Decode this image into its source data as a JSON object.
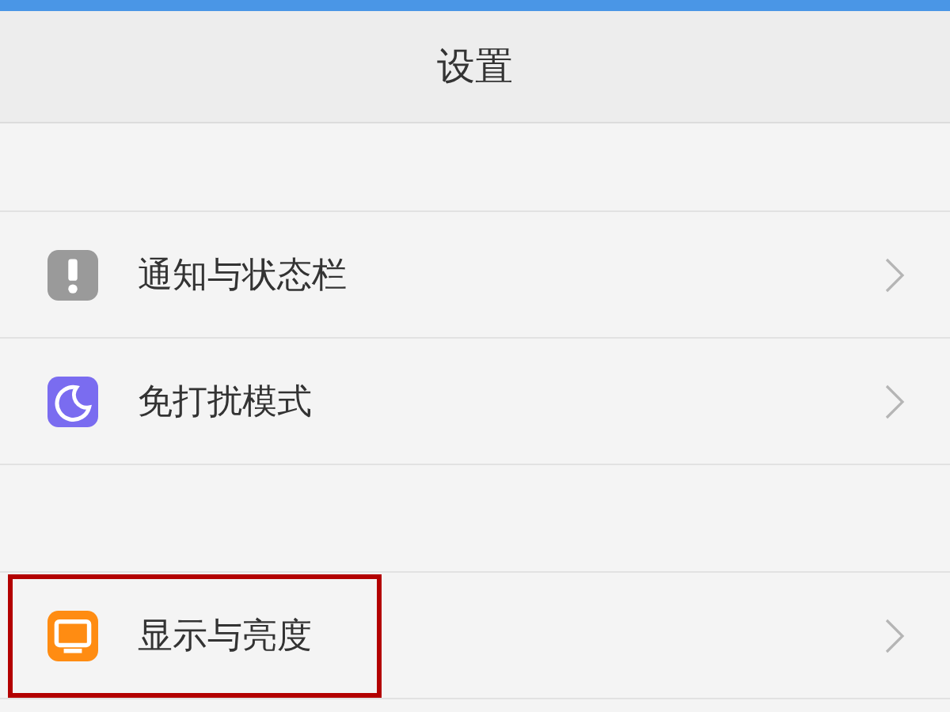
{
  "header": {
    "title": "设置"
  },
  "sections": [
    {
      "items": [
        {
          "kind": "notification",
          "color": "#9a9a9a",
          "label": "通知与状态栏",
          "highlighted": false
        },
        {
          "kind": "moon",
          "color": "#7a6cf0",
          "label": "免打扰模式",
          "highlighted": false
        }
      ]
    },
    {
      "items": [
        {
          "kind": "display",
          "color": "#ff8c12",
          "label": "显示与亮度",
          "highlighted": true
        }
      ]
    }
  ]
}
